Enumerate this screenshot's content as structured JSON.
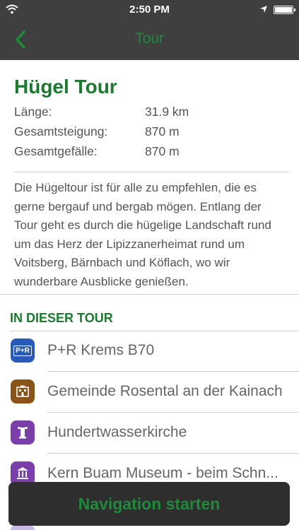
{
  "status_bar": {
    "time": "2:50 PM"
  },
  "nav_bar": {
    "back_icon": "chevron-left-icon",
    "title": "Tour"
  },
  "tour": {
    "title": "Hügel Tour",
    "stats": [
      {
        "label": "Länge:",
        "value": "31.9 km"
      },
      {
        "label": "Gesamtsteigung:",
        "value": "870 m"
      },
      {
        "label": "Gesamtgefälle:",
        "value": "870 m"
      }
    ],
    "description": "Die Hügeltour ist für alle zu empfehlen, die es gerne bergauf und bergab mögen. Entlang der Tour geht es durch die hügelige Landschaft rund um das Herz der Lipizzanerheimat rund um Voitsberg, Bärnbach und Köflach, wo wir wunderbare Ausblicke genießen."
  },
  "section": {
    "title": "IN DIESER TOUR"
  },
  "pois": [
    {
      "label": "P+R Krems B70",
      "icon": "park-and-ride-icon",
      "icon_text": "P+R",
      "color": "#2a5ab8"
    },
    {
      "label": "Gemeinde Rosental an der Kainach",
      "icon": "municipality-icon",
      "icon_text": "",
      "color": "#8a5418"
    },
    {
      "label": "Hundertwasserkirche",
      "icon": "column-icon",
      "icon_text": "",
      "color": "#7a3fa8"
    },
    {
      "label": "Kern Buam Museum - beim Schn...",
      "icon": "museum-icon",
      "icon_text": "",
      "color": "#7a3fa8"
    }
  ],
  "colors": {
    "accent_green": "#1a7a2e",
    "nav_bg": "#3f3f3f",
    "button_bg": "#2e2e2e"
  },
  "navigation_button": {
    "label": "Navigation starten"
  }
}
